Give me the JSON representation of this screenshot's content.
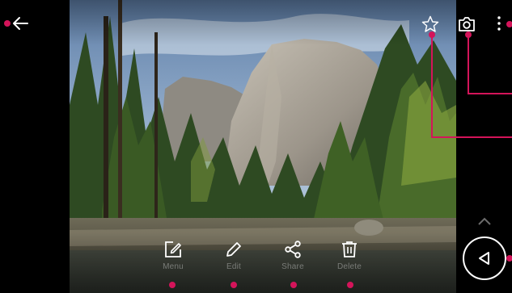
{
  "toolbar": {
    "back_icon": "arrow-left-icon",
    "favorite_icon": "star-outline-icon",
    "camera_icon": "camera-icon",
    "more_icon": "more-vertical-icon"
  },
  "actions": [
    {
      "icon": "edit-square-icon",
      "label": "Menu"
    },
    {
      "icon": "pencil-icon",
      "label": "Edit"
    },
    {
      "icon": "share-icon",
      "label": "Share"
    },
    {
      "icon": "trash-icon",
      "label": "Delete"
    }
  ],
  "navigation": {
    "expand_icon": "chevron-up-icon",
    "back_nav_icon": "triangle-back-icon"
  },
  "colors": {
    "callout": "#d4145a",
    "background": "#000000",
    "icon": "#ffffff"
  }
}
